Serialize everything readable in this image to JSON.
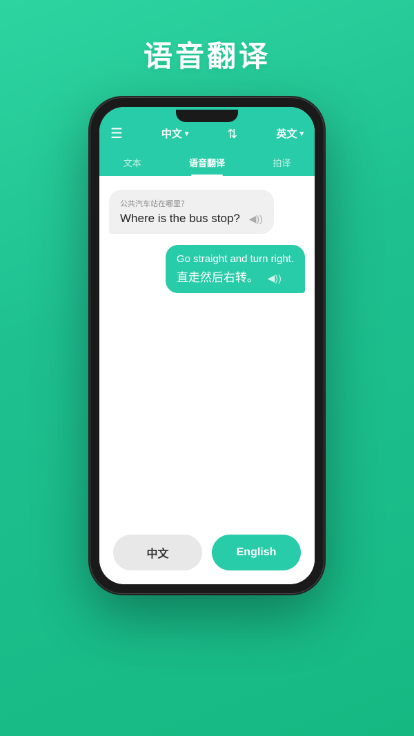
{
  "page": {
    "title": "语音翻译",
    "background_gradient_start": "#2dd4a0",
    "background_gradient_end": "#16b882"
  },
  "phone": {
    "header": {
      "lang_left": "中文",
      "lang_right": "英文",
      "swap_label": "⇄"
    },
    "tabs": [
      {
        "label": "文本",
        "active": false
      },
      {
        "label": "语音翻译",
        "active": true
      },
      {
        "label": "拍译",
        "active": false
      }
    ],
    "messages": [
      {
        "side": "left",
        "sub_text": "公共汽车站在哪里？",
        "main_text": "Where is the bus stop?",
        "speaker": "◀))"
      },
      {
        "side": "right",
        "main_text_top": "Go straight and turn right.",
        "main_text_bottom": "直走然后右转。",
        "speaker": "◀))"
      }
    ],
    "buttons": {
      "chinese_label": "中文",
      "english_label": "English"
    }
  }
}
